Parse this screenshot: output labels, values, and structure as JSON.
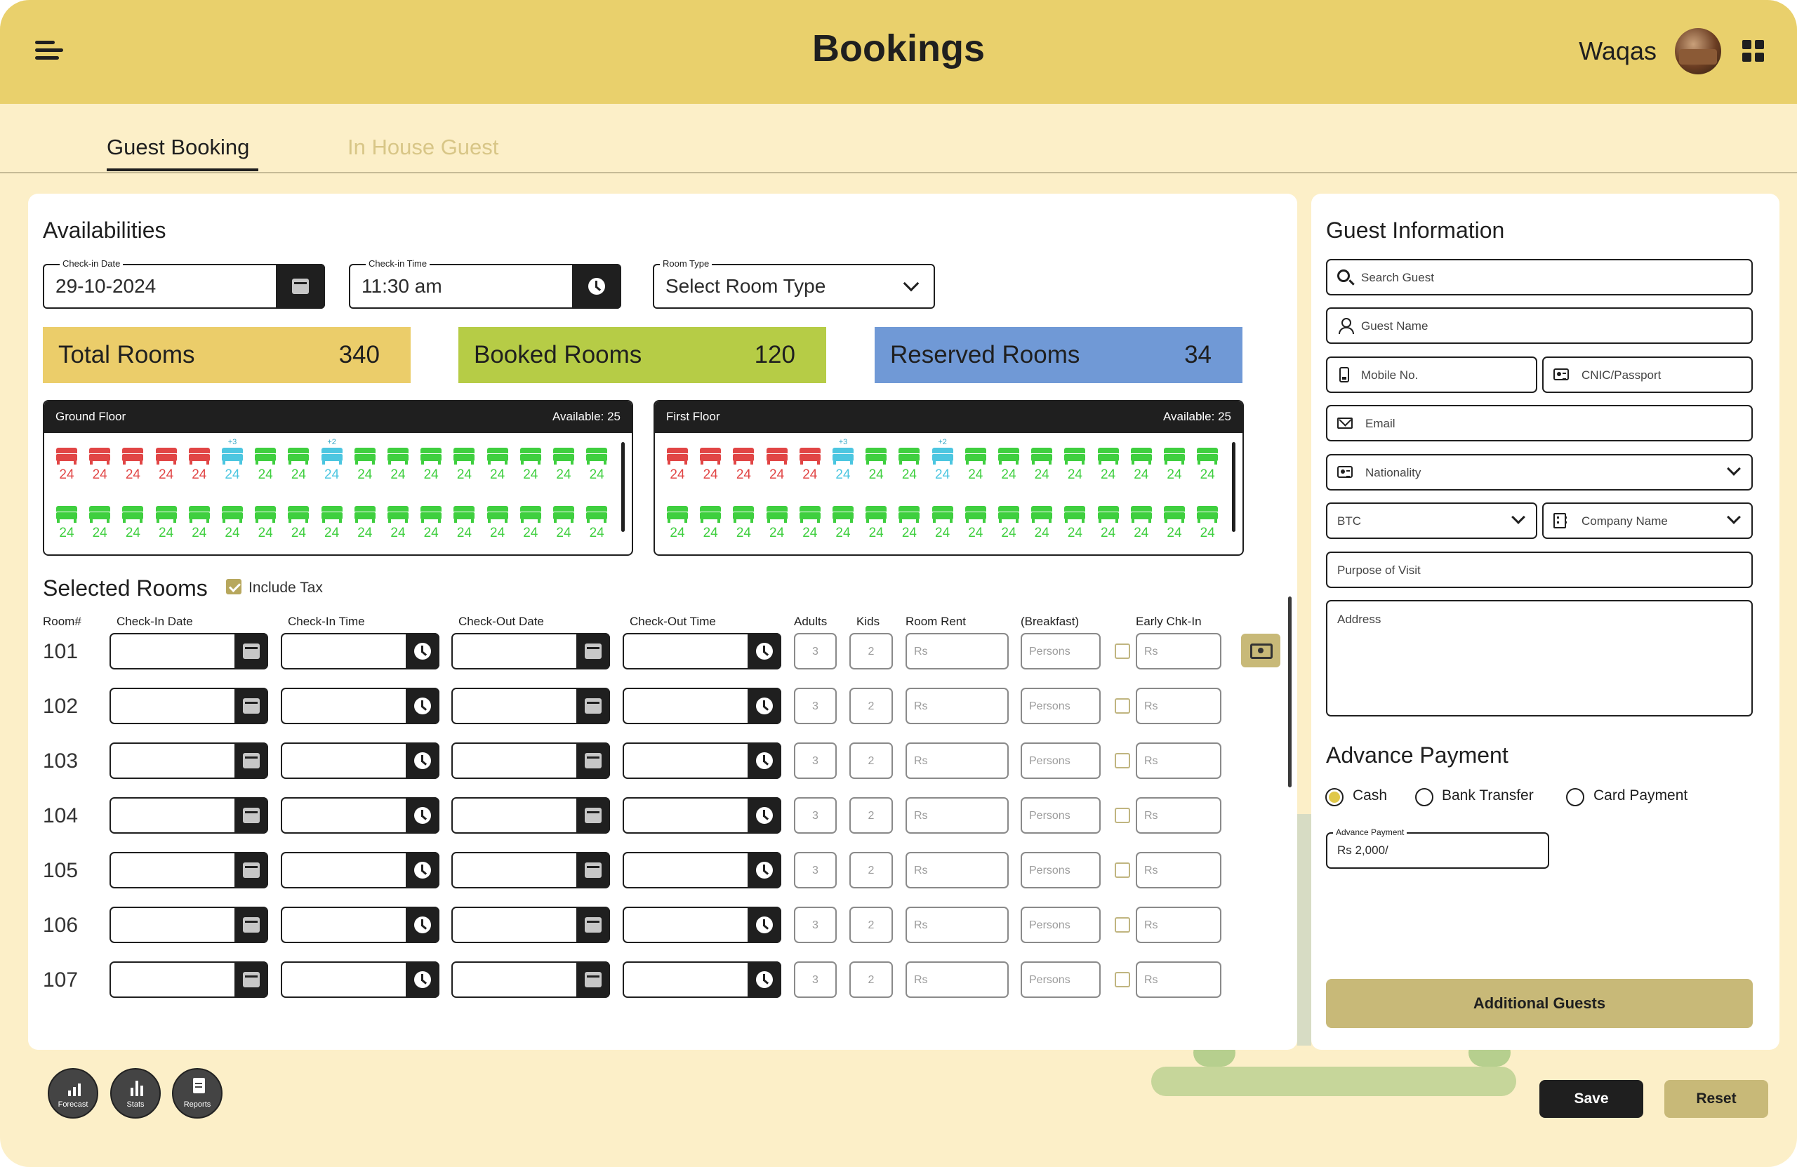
{
  "header": {
    "title": "Bookings",
    "user_name": "Waqas"
  },
  "tabs": [
    {
      "label": "Guest Booking",
      "active": true
    },
    {
      "label": "In House Guest",
      "active": false
    }
  ],
  "availabilities": {
    "title": "Availabilities",
    "checkin_date": {
      "label": "Check-in Date",
      "value": "29-10-2024"
    },
    "checkin_time": {
      "label": "Check-in Time",
      "value": "11:30 am"
    },
    "room_type": {
      "label": "Room Type",
      "value": "Select Room Type"
    }
  },
  "stats": [
    {
      "label": "Total Rooms",
      "value": "340",
      "color": "#ebcd6a"
    },
    {
      "label": "Booked Rooms",
      "value": "120",
      "color": "#b6cc46"
    },
    {
      "label": "Reserved Rooms",
      "value": "34",
      "color": "#7099d6"
    }
  ],
  "floors": [
    {
      "name": "Ground Floor",
      "available": "Available: 25",
      "rows": [
        [
          {
            "num": "24",
            "status": "booked"
          },
          {
            "num": "24",
            "status": "booked"
          },
          {
            "num": "24",
            "status": "booked"
          },
          {
            "num": "24",
            "status": "booked"
          },
          {
            "num": "24",
            "status": "booked"
          },
          {
            "num": "24",
            "status": "reserved",
            "badge": "+3"
          },
          {
            "num": "24",
            "status": "available"
          },
          {
            "num": "24",
            "status": "available"
          },
          {
            "num": "24",
            "status": "reserved",
            "badge": "+2"
          },
          {
            "num": "24",
            "status": "available"
          },
          {
            "num": "24",
            "status": "available"
          },
          {
            "num": "24",
            "status": "available"
          },
          {
            "num": "24",
            "status": "available"
          },
          {
            "num": "24",
            "status": "available"
          },
          {
            "num": "24",
            "status": "available"
          },
          {
            "num": "24",
            "status": "available"
          },
          {
            "num": "24",
            "status": "available"
          }
        ],
        [
          {
            "num": "24",
            "status": "available"
          },
          {
            "num": "24",
            "status": "available"
          },
          {
            "num": "24",
            "status": "available"
          },
          {
            "num": "24",
            "status": "available"
          },
          {
            "num": "24",
            "status": "available"
          },
          {
            "num": "24",
            "status": "available"
          },
          {
            "num": "24",
            "status": "available"
          },
          {
            "num": "24",
            "status": "available"
          },
          {
            "num": "24",
            "status": "available"
          },
          {
            "num": "24",
            "status": "available"
          },
          {
            "num": "24",
            "status": "available"
          },
          {
            "num": "24",
            "status": "available"
          },
          {
            "num": "24",
            "status": "available"
          },
          {
            "num": "24",
            "status": "available"
          },
          {
            "num": "24",
            "status": "available"
          },
          {
            "num": "24",
            "status": "available"
          },
          {
            "num": "24",
            "status": "available"
          }
        ]
      ]
    },
    {
      "name": "First Floor",
      "available": "Available: 25",
      "rows": [
        [
          {
            "num": "24",
            "status": "booked"
          },
          {
            "num": "24",
            "status": "booked"
          },
          {
            "num": "24",
            "status": "booked"
          },
          {
            "num": "24",
            "status": "booked"
          },
          {
            "num": "24",
            "status": "booked"
          },
          {
            "num": "24",
            "status": "reserved",
            "badge": "+3"
          },
          {
            "num": "24",
            "status": "available"
          },
          {
            "num": "24",
            "status": "available"
          },
          {
            "num": "24",
            "status": "reserved",
            "badge": "+2"
          },
          {
            "num": "24",
            "status": "available"
          },
          {
            "num": "24",
            "status": "available"
          },
          {
            "num": "24",
            "status": "available"
          },
          {
            "num": "24",
            "status": "available"
          },
          {
            "num": "24",
            "status": "available"
          },
          {
            "num": "24",
            "status": "available"
          },
          {
            "num": "24",
            "status": "available"
          },
          {
            "num": "24",
            "status": "available"
          }
        ],
        [
          {
            "num": "24",
            "status": "available"
          },
          {
            "num": "24",
            "status": "available"
          },
          {
            "num": "24",
            "status": "available"
          },
          {
            "num": "24",
            "status": "available"
          },
          {
            "num": "24",
            "status": "available"
          },
          {
            "num": "24",
            "status": "available"
          },
          {
            "num": "24",
            "status": "available"
          },
          {
            "num": "24",
            "status": "available"
          },
          {
            "num": "24",
            "status": "available"
          },
          {
            "num": "24",
            "status": "available"
          },
          {
            "num": "24",
            "status": "available"
          },
          {
            "num": "24",
            "status": "available"
          },
          {
            "num": "24",
            "status": "available"
          },
          {
            "num": "24",
            "status": "available"
          },
          {
            "num": "24",
            "status": "available"
          },
          {
            "num": "24",
            "status": "available"
          },
          {
            "num": "24",
            "status": "available"
          }
        ]
      ]
    }
  ],
  "room_colors": {
    "booked": "#e14545",
    "reserved": "#4cc6e0",
    "available": "#3fcf3f"
  },
  "selected_rooms": {
    "title": "Selected Rooms",
    "include_tax_label": "Include Tax",
    "include_tax": true,
    "columns": [
      "Room#",
      "Check-In Date",
      "Check-In Time",
      "Check-Out Date",
      "Check-Out Time",
      "Adults",
      "Kids",
      "Room Rent",
      "(Breakfast)",
      "Early Chk-In"
    ],
    "rows": [
      {
        "room": "101",
        "adults": "3",
        "kids": "2",
        "rent": "Rs",
        "breakfast": "Persons",
        "early": "Rs"
      },
      {
        "room": "102",
        "adults": "3",
        "kids": "2",
        "rent": "Rs",
        "breakfast": "Persons",
        "early": "Rs"
      },
      {
        "room": "103",
        "adults": "3",
        "kids": "2",
        "rent": "Rs",
        "breakfast": "Persons",
        "early": "Rs"
      },
      {
        "room": "104",
        "adults": "3",
        "kids": "2",
        "rent": "Rs",
        "breakfast": "Persons",
        "early": "Rs"
      },
      {
        "room": "105",
        "adults": "3",
        "kids": "2",
        "rent": "Rs",
        "breakfast": "Persons",
        "early": "Rs"
      },
      {
        "room": "106",
        "adults": "3",
        "kids": "2",
        "rent": "Rs",
        "breakfast": "Persons",
        "early": "Rs"
      },
      {
        "room": "107",
        "adults": "3",
        "kids": "2",
        "rent": "Rs",
        "breakfast": "Persons",
        "early": "Rs"
      }
    ]
  },
  "guest_info": {
    "title": "Guest Information",
    "search_placeholder": "Search Guest",
    "name_placeholder": "Guest Name",
    "mobile_placeholder": "Mobile No.",
    "cnic_placeholder": "CNIC/Passport",
    "email_placeholder": "Email",
    "nationality_placeholder": "Nationality",
    "btc_value": "BTC",
    "company_placeholder": "Company Name",
    "purpose_placeholder": "Purpose of Visit",
    "address_placeholder": "Address"
  },
  "advance_payment": {
    "title": "Advance Payment",
    "options": [
      {
        "label": "Cash",
        "selected": true
      },
      {
        "label": "Bank Transfer",
        "selected": false
      },
      {
        "label": "Card Payment",
        "selected": false
      }
    ],
    "field_label": "Advance Payment",
    "field_value": "Rs 2,000/"
  },
  "buttons": {
    "additional_guests": "Additional Guests",
    "save": "Save",
    "reset": "Reset"
  },
  "quick_actions": [
    {
      "label": "Forecast",
      "icon": "forecast-icon"
    },
    {
      "label": "Stats",
      "icon": "stats-icon"
    },
    {
      "label": "Reports",
      "icon": "reports-icon"
    }
  ]
}
